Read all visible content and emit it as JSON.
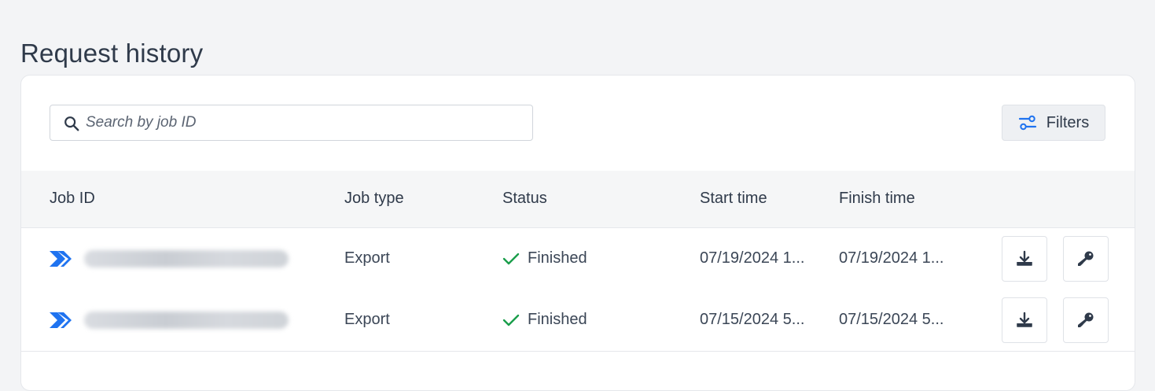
{
  "page": {
    "title": "Request history"
  },
  "search": {
    "placeholder": "Search by job ID"
  },
  "filters": {
    "label": "Filters"
  },
  "table": {
    "columns": [
      "Job ID",
      "Job type",
      "Status",
      "Start time",
      "Finish time"
    ],
    "rows": [
      {
        "job_type": "Export",
        "status": "Finished",
        "start_time": "07/19/2024 1...",
        "finish_time": "07/19/2024 1..."
      },
      {
        "job_type": "Export",
        "status": "Finished",
        "start_time": "07/15/2024 5...",
        "finish_time": "07/15/2024 5..."
      }
    ]
  },
  "icons": {
    "search": "search-icon",
    "filters": "sliders-icon",
    "job": "zendesk-chevron-icon",
    "status": "check-icon",
    "download": "download-icon",
    "key": "key-icon"
  },
  "colors": {
    "accent": "#1f73f0",
    "success": "#1a9e4b",
    "background": "#f3f4f6",
    "text": "#2f3a4a"
  }
}
